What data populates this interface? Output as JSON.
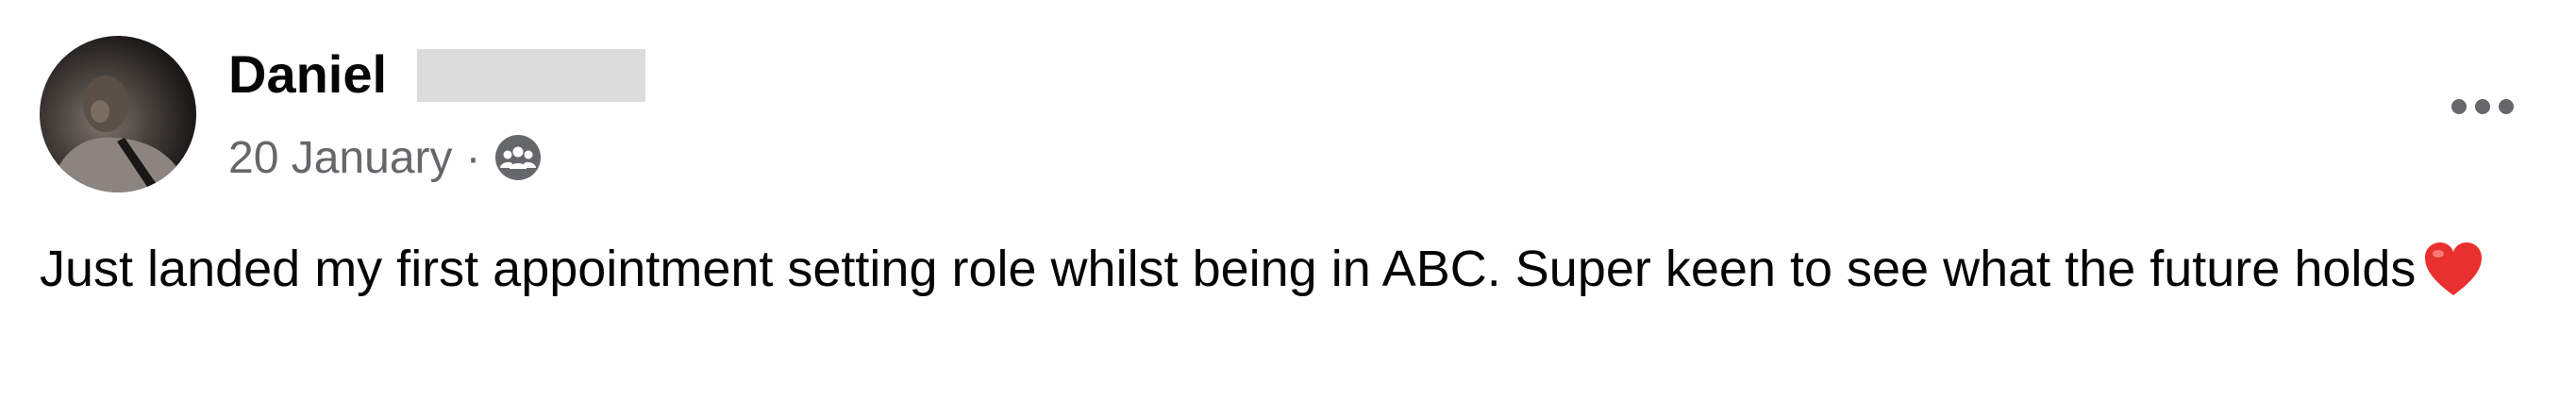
{
  "post": {
    "author": {
      "name": "Daniel",
      "avatar_icon": "profile-photo"
    },
    "date": "20 January",
    "separator": "·",
    "audience_icon": "friends-icon",
    "menu_icon": "more-options-icon",
    "text": "Just landed my first appointment setting role whilst being in ABC. Super keen to see what the future holds",
    "emoji": "red-heart-icon"
  },
  "colors": {
    "primary_text": "#050505",
    "secondary_text": "#65676b",
    "redaction": "#dcdcdc",
    "heart": "#e8302f"
  }
}
